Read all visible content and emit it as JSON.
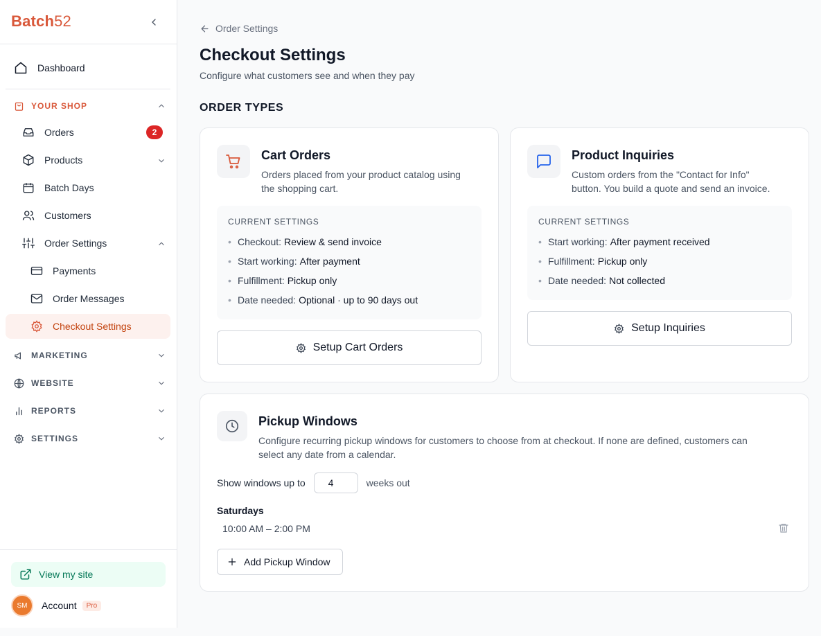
{
  "brand": {
    "name_text": "Batch",
    "name_num": "52",
    "color": "#d9583a"
  },
  "sidebar": {
    "dashboard": "Dashboard",
    "your_shop": "YOUR SHOP",
    "items": {
      "orders": "Orders",
      "orders_badge": "2",
      "products": "Products",
      "batch_days": "Batch Days",
      "customers": "Customers",
      "order_settings": "Order Settings",
      "payments": "Payments",
      "order_messages": "Order Messages",
      "checkout_settings": "Checkout Settings"
    },
    "sections": {
      "marketing": "MARKETING",
      "website": "WEBSITE",
      "reports": "REPORTS",
      "settings": "SETTINGS"
    },
    "view_site": "View my site",
    "account": {
      "initials": "SM",
      "label": "Account",
      "plan": "Pro"
    }
  },
  "main": {
    "back_label": "Order Settings",
    "title": "Checkout Settings",
    "subtitle": "Configure what customers see and when they pay",
    "order_types_heading": "ORDER TYPES",
    "cart_orders": {
      "title": "Cart Orders",
      "desc_line1": "Orders placed from your product catalog using",
      "desc_line2": "the shopping cart.",
      "settings_heading": "CURRENT SETTINGS",
      "rows": [
        {
          "label": "Checkout:",
          "value": "Review & send invoice"
        },
        {
          "label": "Start working:",
          "value": "After payment"
        },
        {
          "label": "Fulfillment:",
          "value": "Pickup only"
        },
        {
          "label": "Date needed:",
          "value": "Optional · up to 90 days out"
        }
      ],
      "button": "Setup Cart Orders"
    },
    "inquiries": {
      "title": "Product Inquiries",
      "desc_line1": "Custom orders from the \"Contact for Info\"",
      "desc_line2": "button. You build a quote and send an invoice.",
      "settings_heading": "CURRENT SETTINGS",
      "rows": [
        {
          "label": "Start working:",
          "value": "After payment received"
        },
        {
          "label": "Fulfillment:",
          "value": "Pickup only"
        },
        {
          "label": "Date needed:",
          "value": "Not collected"
        }
      ],
      "button": "Setup Inquiries"
    },
    "pickup": {
      "title": "Pickup Windows",
      "desc_line1": "Configure recurring pickup windows for customers to choose from at checkout. If none are defined, customers can",
      "desc_line2": "select any date from a calendar.",
      "weeks_pre": "Show windows up to",
      "weeks_value": "4",
      "weeks_post": "weeks out",
      "day": "Saturdays",
      "time": "10:00 AM – 2:00 PM",
      "add_button": "Add Pickup Window"
    }
  }
}
